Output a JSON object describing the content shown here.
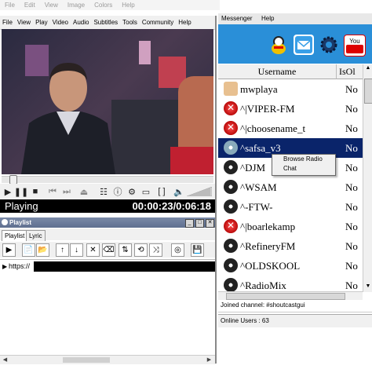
{
  "background_menu": [
    "File",
    "Edit",
    "View",
    "Image",
    "Colors",
    "Help"
  ],
  "player": {
    "menu": [
      "File",
      "View",
      "Play",
      "Video",
      "Audio",
      "Subtitles",
      "Tools",
      "Community",
      "Help"
    ],
    "state": "Playing",
    "time": "00:00:23/0:06:18",
    "seek_fraction": 0.04,
    "volume_fraction": 0.95
  },
  "playlist": {
    "title": "Playlist",
    "tabs": [
      "Playlist",
      "Lyric"
    ],
    "items": [
      {
        "text": "https://"
      }
    ]
  },
  "messenger": {
    "menu": [
      "Messenger",
      "Help"
    ],
    "columns": [
      "Username",
      "IsOl"
    ],
    "rows": [
      {
        "name": "mwplaya",
        "val": "No",
        "icon": "user-icon"
      },
      {
        "name": "^|VIPER-FM",
        "val": "No",
        "icon": "offline-x-icon"
      },
      {
        "name": "^|choosename_t",
        "val": "No",
        "icon": "offline-x-icon"
      },
      {
        "name": "^safsa_v3",
        "val": "No",
        "icon": "disc-icon",
        "selected": true
      },
      {
        "name": "^DJM",
        "val": "No",
        "icon": "disc-icon"
      },
      {
        "name": "^WSAM",
        "val": "No",
        "icon": "disc-icon"
      },
      {
        "name": "^-FTW-",
        "val": "No",
        "icon": "disc-icon"
      },
      {
        "name": "^|boarlekamp",
        "val": "No",
        "icon": "offline-x-icon"
      },
      {
        "name": "^RefineryFM",
        "val": "No",
        "icon": "disc-icon"
      },
      {
        "name": "^OLDSKOOL",
        "val": "No",
        "icon": "disc-icon"
      },
      {
        "name": "^RadioMix",
        "val": "No",
        "icon": "disc-icon"
      }
    ],
    "context_menu": [
      "Browse Radio",
      "Chat"
    ],
    "joined": "Joined channel: #shoutcastgui",
    "online": "Online Users : 63",
    "toolbar_icons": [
      "buddy-icon",
      "mail-icon",
      "gear-icon",
      "youtube-icon"
    ],
    "youtube_label": "You"
  }
}
